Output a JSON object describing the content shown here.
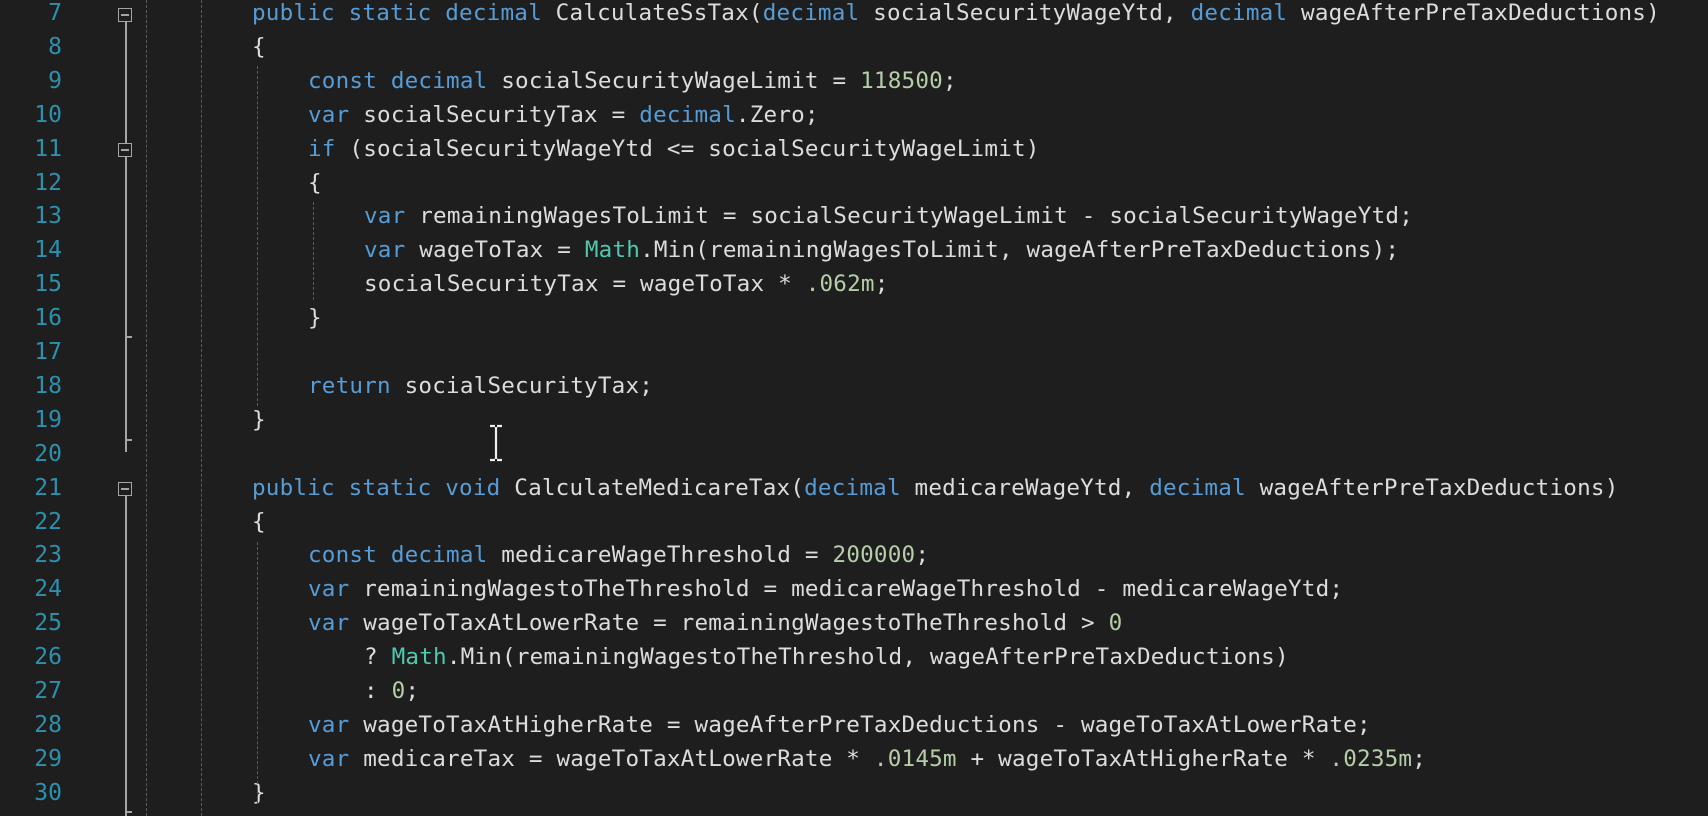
{
  "editor": {
    "lines": [
      {
        "num": "7",
        "indent": 1,
        "tokens": [
          {
            "t": "public ",
            "c": "kw"
          },
          {
            "t": "static ",
            "c": "kw"
          },
          {
            "t": "decimal ",
            "c": "kw"
          },
          {
            "t": "CalculateSsTax(",
            "c": "plain"
          },
          {
            "t": "decimal ",
            "c": "kw"
          },
          {
            "t": "socialSecurityWageYtd, ",
            "c": "plain"
          },
          {
            "t": "decimal ",
            "c": "kw"
          },
          {
            "t": "wageAfterPreTaxDeductions)",
            "c": "plain"
          }
        ]
      },
      {
        "num": "8",
        "indent": 1,
        "tokens": [
          {
            "t": "{",
            "c": "plain"
          }
        ]
      },
      {
        "num": "9",
        "indent": 2,
        "tokens": [
          {
            "t": "const ",
            "c": "kw"
          },
          {
            "t": "decimal ",
            "c": "kw"
          },
          {
            "t": "socialSecurityWageLimit = ",
            "c": "plain"
          },
          {
            "t": "118500",
            "c": "num"
          },
          {
            "t": ";",
            "c": "plain"
          }
        ]
      },
      {
        "num": "10",
        "indent": 2,
        "tokens": [
          {
            "t": "var ",
            "c": "kw"
          },
          {
            "t": "socialSecurityTax = ",
            "c": "plain"
          },
          {
            "t": "decimal",
            "c": "kw"
          },
          {
            "t": ".Zero;",
            "c": "plain"
          }
        ]
      },
      {
        "num": "11",
        "indent": 2,
        "tokens": [
          {
            "t": "if ",
            "c": "kw"
          },
          {
            "t": "(socialSecurityWageYtd <= socialSecurityWageLimit)",
            "c": "plain"
          }
        ]
      },
      {
        "num": "12",
        "indent": 2,
        "tokens": [
          {
            "t": "{",
            "c": "plain"
          }
        ]
      },
      {
        "num": "13",
        "indent": 3,
        "tokens": [
          {
            "t": "var ",
            "c": "kw"
          },
          {
            "t": "remainingWagesToLimit = socialSecurityWageLimit - socialSecurityWageYtd;",
            "c": "plain"
          }
        ]
      },
      {
        "num": "14",
        "indent": 3,
        "tokens": [
          {
            "t": "var ",
            "c": "kw"
          },
          {
            "t": "wageToTax = ",
            "c": "plain"
          },
          {
            "t": "Math",
            "c": "type"
          },
          {
            "t": ".Min(remainingWagesToLimit, wageAfterPreTaxDeductions);",
            "c": "plain"
          }
        ]
      },
      {
        "num": "15",
        "indent": 3,
        "tokens": [
          {
            "t": "socialSecurityTax = wageToTax * ",
            "c": "plain"
          },
          {
            "t": ".062m",
            "c": "num"
          },
          {
            "t": ";",
            "c": "plain"
          }
        ]
      },
      {
        "num": "16",
        "indent": 2,
        "tokens": [
          {
            "t": "}",
            "c": "plain"
          }
        ]
      },
      {
        "num": "17",
        "indent": 2,
        "tokens": []
      },
      {
        "num": "18",
        "indent": 2,
        "tokens": [
          {
            "t": "return ",
            "c": "kw"
          },
          {
            "t": "socialSecurityTax;",
            "c": "plain"
          }
        ]
      },
      {
        "num": "19",
        "indent": 1,
        "tokens": [
          {
            "t": "}",
            "c": "plain"
          }
        ]
      },
      {
        "num": "20",
        "indent": 1,
        "tokens": []
      },
      {
        "num": "21",
        "indent": 1,
        "tokens": [
          {
            "t": "public ",
            "c": "kw"
          },
          {
            "t": "static ",
            "c": "kw"
          },
          {
            "t": "void ",
            "c": "kw"
          },
          {
            "t": "CalculateMedicareTax(",
            "c": "plain"
          },
          {
            "t": "decimal ",
            "c": "kw"
          },
          {
            "t": "medicareWageYtd, ",
            "c": "plain"
          },
          {
            "t": "decimal ",
            "c": "kw"
          },
          {
            "t": "wageAfterPreTaxDeductions)",
            "c": "plain"
          }
        ]
      },
      {
        "num": "22",
        "indent": 1,
        "tokens": [
          {
            "t": "{",
            "c": "plain"
          }
        ]
      },
      {
        "num": "23",
        "indent": 2,
        "tokens": [
          {
            "t": "const ",
            "c": "kw"
          },
          {
            "t": "decimal ",
            "c": "kw"
          },
          {
            "t": "medicareWageThreshold = ",
            "c": "plain"
          },
          {
            "t": "200000",
            "c": "num"
          },
          {
            "t": ";",
            "c": "plain"
          }
        ]
      },
      {
        "num": "24",
        "indent": 2,
        "tokens": [
          {
            "t": "var ",
            "c": "kw"
          },
          {
            "t": "remainingWagestoTheThreshold = medicareWageThreshold - medicareWageYtd;",
            "c": "plain"
          }
        ]
      },
      {
        "num": "25",
        "indent": 2,
        "tokens": [
          {
            "t": "var ",
            "c": "kw"
          },
          {
            "t": "wageToTaxAtLowerRate = remainingWagestoTheThreshold > ",
            "c": "plain"
          },
          {
            "t": "0",
            "c": "num"
          }
        ]
      },
      {
        "num": "26",
        "indent": 3,
        "tokens": [
          {
            "t": "? ",
            "c": "plain"
          },
          {
            "t": "Math",
            "c": "type"
          },
          {
            "t": ".Min(remainingWagestoTheThreshold, wageAfterPreTaxDeductions)",
            "c": "plain"
          }
        ]
      },
      {
        "num": "27",
        "indent": 3,
        "tokens": [
          {
            "t": ": ",
            "c": "plain"
          },
          {
            "t": "0",
            "c": "num"
          },
          {
            "t": ";",
            "c": "plain"
          }
        ]
      },
      {
        "num": "28",
        "indent": 2,
        "tokens": [
          {
            "t": "var ",
            "c": "kw"
          },
          {
            "t": "wageToTaxAtHigherRate = wageAfterPreTaxDeductions - wageToTaxAtLowerRate;",
            "c": "plain"
          }
        ]
      },
      {
        "num": "29",
        "indent": 2,
        "tokens": [
          {
            "t": "var ",
            "c": "kw"
          },
          {
            "t": "medicareTax = wageToTaxAtLowerRate * ",
            "c": "plain"
          },
          {
            "t": ".0145m",
            "c": "num"
          },
          {
            "t": " + wageToTaxAtHigherRate * ",
            "c": "plain"
          },
          {
            "t": ".0235m",
            "c": "num"
          },
          {
            "t": ";",
            "c": "plain"
          }
        ]
      },
      {
        "num": "30",
        "indent": 1,
        "tokens": [
          {
            "t": "}",
            "c": "plain"
          }
        ]
      }
    ]
  },
  "colors": {
    "background": "#1e1e1e",
    "line_number": "#2b91af",
    "keyword": "#569cd6",
    "type": "#4ec9b0",
    "number": "#b5cea8",
    "text": "#dcdcdc"
  },
  "cursor": {
    "icon": "text-cursor-ibeam-icon"
  }
}
